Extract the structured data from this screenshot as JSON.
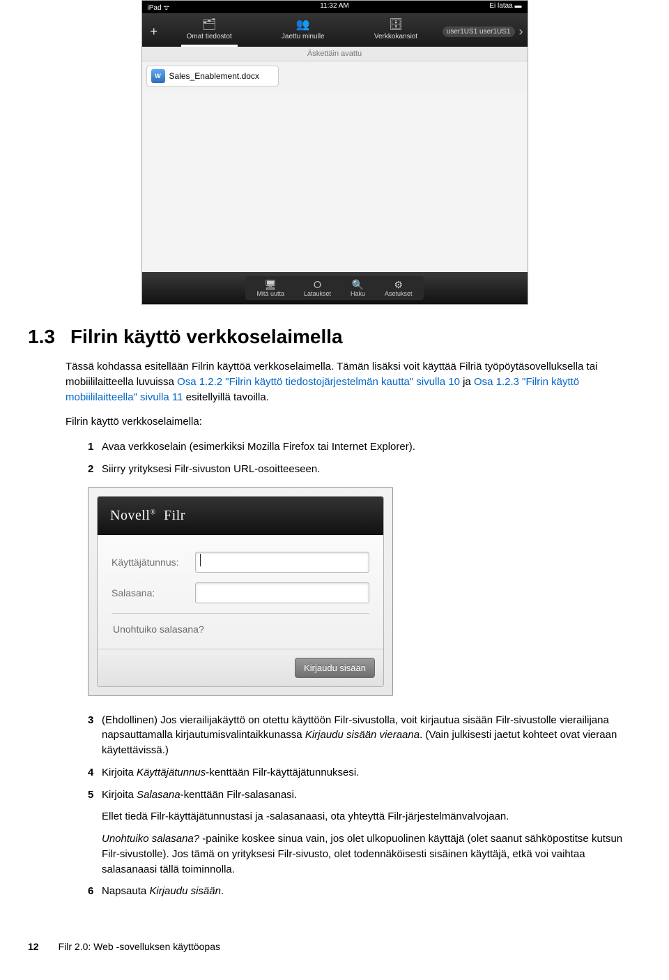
{
  "tablet": {
    "status_left": "iPad ᯤ",
    "status_center": "11:32 AM",
    "status_right": "Ei lataa ▬",
    "user_label": "user1US1 user1US1",
    "nav": {
      "tab1": "Omat tiedostot",
      "tab2": "Jaettu minulle",
      "tab3": "Verkkokansiot"
    },
    "subheader": "Äskettäin avattu",
    "doc_type": "W",
    "file_name": "Sales_Enablement.docx",
    "bottom": {
      "b1": "Mitä uutta",
      "b2": "Lataukset",
      "b3": "Haku",
      "b4": "Asetukset"
    }
  },
  "section": {
    "num": "1.3",
    "title": "Filrin käyttö verkkoselaimella",
    "intro_a": "Tässä kohdassa esitellään Filrin käyttöä verkkoselaimella. Tämän lisäksi voit käyttää Filriä työpöytäsovelluksella tai mobiililaitteella luvuissa ",
    "xref1": "Osa 1.2.2 \"Filrin käyttö tiedostojärjestelmän kautta\" sivulla 10",
    "intro_b": " ja ",
    "xref2": "Osa 1.2.3 \"Filrin käyttö mobiililaitteella\" sivulla 11",
    "intro_c": " esitellyillä tavoilla.",
    "lead": "Filrin käyttö verkkoselaimella:"
  },
  "steps": {
    "s1": "Avaa verkkoselain (esimerkiksi Mozilla Firefox tai Internet Explorer).",
    "s2": "Siirry yrityksesi Filr-sivuston URL-osoitteeseen.",
    "s3_a": "(Ehdollinen) Jos vierailijakäyttö on otettu käyttöön Filr-sivustolla, voit kirjautua sisään Filr-sivustolle vierailijana napsauttamalla kirjautumisvalintaikkunassa ",
    "s3_em": "Kirjaudu sisään vieraana",
    "s3_b": ". (Vain julkisesti jaetut kohteet ovat vieraan käytettävissä.)",
    "s4_a": "Kirjoita ",
    "s4_em": "Käyttäjätunnus",
    "s4_b": "-kenttään Filr-käyttäjätunnuksesi.",
    "s5_a": "Kirjoita ",
    "s5_em": "Salasana",
    "s5_b": "-kenttään Filr-salasanasi.",
    "s5_c": "Ellet tiedä Filr-käyttäjätunnustasi ja -salasanaasi, ota yhteyttä Filr-järjestelmänvalvojaan.",
    "s5_d_em": "Unohtuiko salasana?",
    "s5_d": " -painike koskee sinua vain, jos olet ulkopuolinen käyttäjä (olet saanut sähköpostitse kutsun Filr-sivustolle). Jos tämä on yrityksesi Filr-sivusto, olet todennäköisesti sisäinen käyttäjä, etkä voi vaihtaa salasanaasi tällä toiminnolla.",
    "s6_a": "Napsauta ",
    "s6_em": "Kirjaudu sisään",
    "s6_b": "."
  },
  "login": {
    "brand_a": "Novell",
    "brand_b": "Filr",
    "label_user": "Käyttäjätunnus:",
    "label_pass": "Salasana:",
    "forgot": "Unohtuiko salasana?",
    "button": "Kirjaudu sisään"
  },
  "footer": {
    "pagenum": "12",
    "doctitle": "Filr 2.0: Web -sovelluksen käyttöopas"
  }
}
